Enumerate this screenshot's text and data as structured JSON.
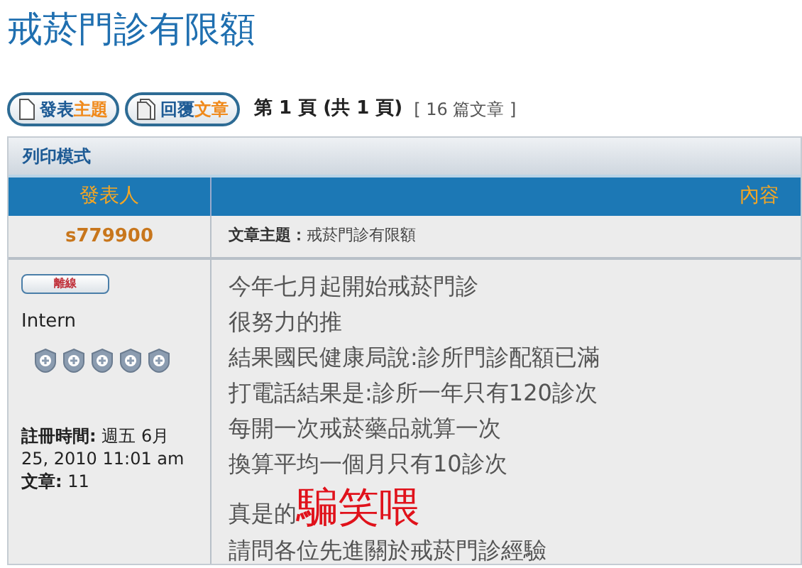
{
  "page_title": "戒菸門診有限額",
  "buttons": [
    {
      "kind": "new",
      "parts": [
        "發表",
        "主題"
      ]
    },
    {
      "kind": "reply",
      "parts": [
        "回覆",
        "文章"
      ]
    }
  ],
  "pagination": {
    "label_parts": [
      "第 ",
      "1",
      " 頁 (共 ",
      "1",
      " 頁)"
    ],
    "count": "[ 16 篇文章 ]"
  },
  "print_mode": "列印模式",
  "columns": [
    "發表人",
    "內容"
  ],
  "post": {
    "author": "s779900",
    "subject_label": "文章主題：",
    "subject": "戒菸門診有限額",
    "status": "離線",
    "rank": "Intern",
    "joined_label": "註冊時間:",
    "joined": "週五 6月 25, 2010 11:01 am",
    "posts_label": "文章:",
    "posts": "11",
    "lines": [
      [
        {
          "kind": "plain",
          "text": "今年七月起開始戒菸門診"
        }
      ],
      [
        {
          "kind": "plain",
          "text": "很努力的推"
        }
      ],
      [
        {
          "kind": "plain",
          "text": "結果國民健康局說:診所門診配額已滿"
        }
      ],
      [
        {
          "kind": "plain",
          "text": "打電話結果是:診所一年只有120診次"
        }
      ],
      [
        {
          "kind": "plain",
          "text": "每開一次戒菸藥品就算一次"
        }
      ],
      [
        {
          "kind": "plain",
          "text": "換算平均一個月只有10診次"
        }
      ],
      [
        {
          "kind": "plain",
          "text": "真是的"
        },
        {
          "kind": "emphasis",
          "text": "騙笑喂"
        }
      ],
      [
        {
          "kind": "plain",
          "text": "請問各位先進關於戒菸門診經驗"
        }
      ]
    ]
  }
}
